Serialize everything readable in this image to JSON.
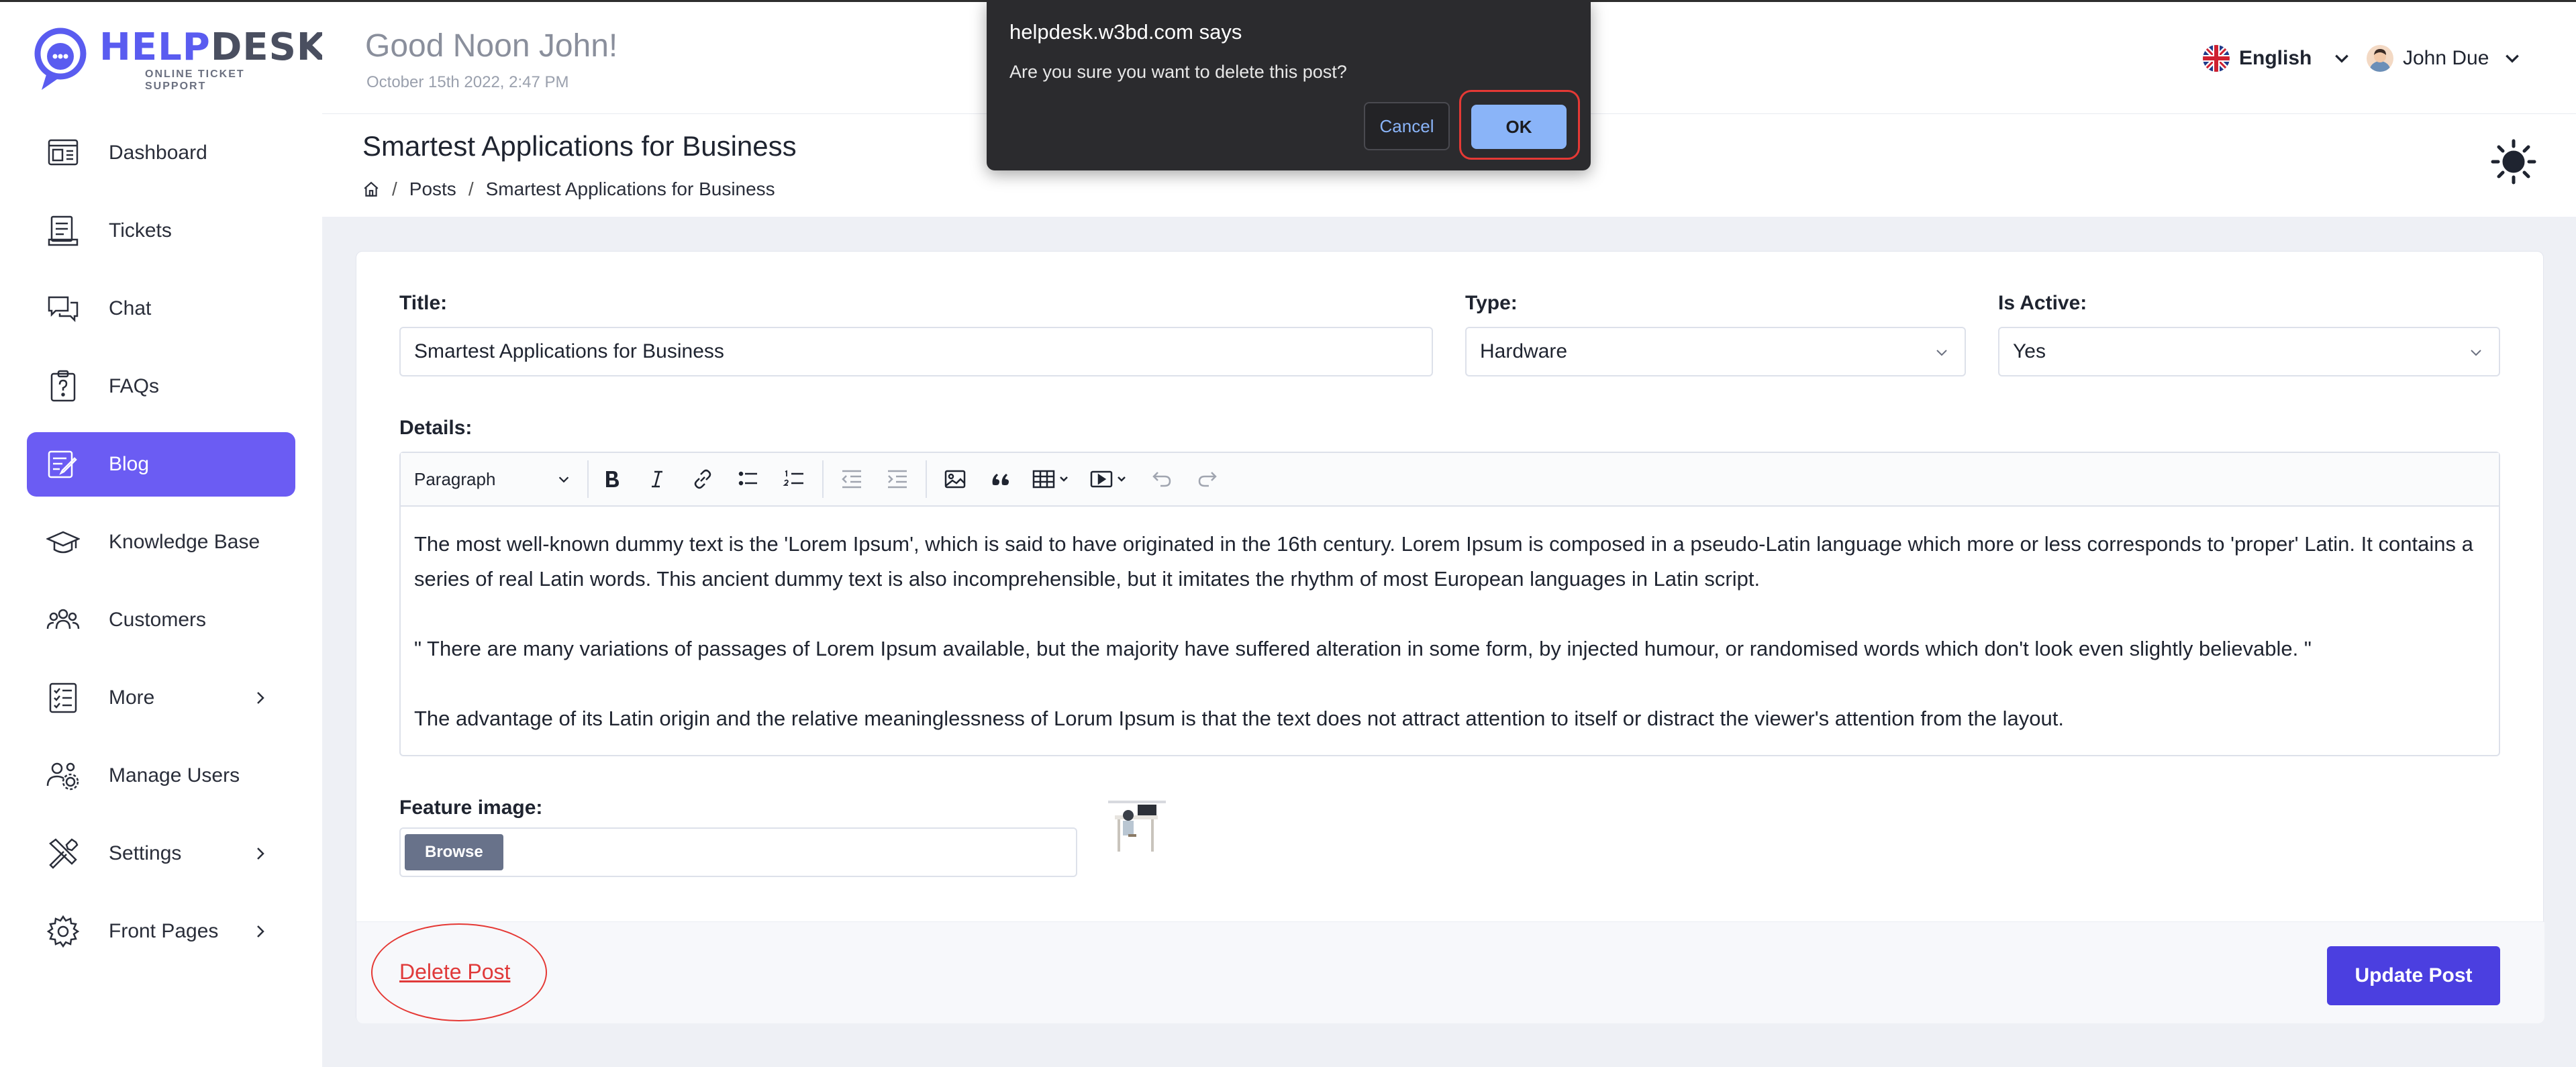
{
  "logo": {
    "brand_a": "HELP",
    "brand_b": "DESK",
    "tagline": "ONLINE TICKET SUPPORT"
  },
  "sidebar": {
    "items": [
      {
        "label": "Dashboard",
        "icon": "dashboard-icon"
      },
      {
        "label": "Tickets",
        "icon": "ticket-icon"
      },
      {
        "label": "Chat",
        "icon": "chat-icon"
      },
      {
        "label": "FAQs",
        "icon": "faq-icon"
      },
      {
        "label": "Blog",
        "icon": "blog-icon",
        "active": true
      },
      {
        "label": "Knowledge Base",
        "icon": "graduation-cap-icon"
      },
      {
        "label": "Customers",
        "icon": "customers-icon"
      },
      {
        "label": "More",
        "icon": "list-icon",
        "has_submenu": true
      },
      {
        "label": "Manage Users",
        "icon": "user-gear-icon"
      },
      {
        "label": "Settings",
        "icon": "tools-icon",
        "has_submenu": true
      },
      {
        "label": "Front Pages",
        "icon": "gear-icon",
        "has_submenu": true
      }
    ],
    "active_color": "#6b5cf3"
  },
  "header": {
    "greeting": "Good Noon John!",
    "date": "October 15th 2022, 2:47 PM",
    "language": "English",
    "user": "John Due"
  },
  "page": {
    "title": "Smartest Applications for Business",
    "breadcrumb": [
      "Posts",
      "Smartest Applications for Business"
    ]
  },
  "form": {
    "title_label": "Title:",
    "title_value": "Smartest Applications for Business",
    "type_label": "Type:",
    "type_value": "Hardware",
    "active_label": "Is Active:",
    "active_value": "Yes",
    "details_label": "Details:",
    "editor_format": "Paragraph",
    "paragraphs": [
      "The most well-known dummy text is the 'Lorem Ipsum', which is said to have originated in the 16th century. Lorem Ipsum is composed in a pseudo-Latin language which more or less corresponds to 'proper' Latin. It contains a series of real Latin words. This ancient dummy text is also incomprehensible, but it imitates the rhythm of most European languages in Latin script.",
      "\" There are many variations of passages of Lorem Ipsum available, but the majority have suffered alteration in some form, by injected humour, or randomised words which don't look even slightly believable. \"",
      "The advantage of its Latin origin and the relative meaninglessness of Lorum Ipsum is that the text does not attract attention to itself or distract the viewer's attention from the layout."
    ],
    "feature_label": "Feature image:",
    "browse_label": "Browse",
    "delete_label": "Delete Post",
    "update_label": "Update Post"
  },
  "dialog": {
    "title": "helpdesk.w3bd.com says",
    "message": "Are you sure you want to delete this post?",
    "cancel": "Cancel",
    "ok": "OK"
  },
  "colors": {
    "accent": "#4b3fe0",
    "danger": "#e53935",
    "dialog_bg": "#2b2b2e",
    "dialog_ok": "#8ab4f8"
  }
}
